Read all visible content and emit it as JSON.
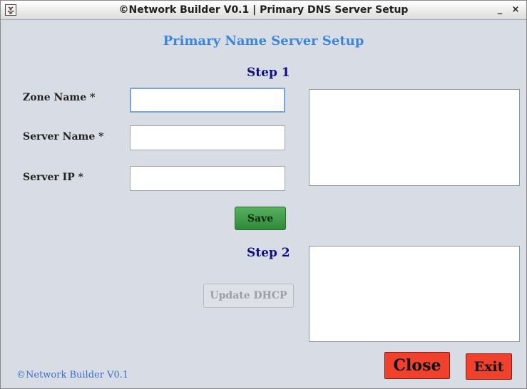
{
  "window": {
    "title": "©Network Builder V0.1 | Primary DNS Server Setup",
    "minimize_symbol": "_",
    "close_symbol": "×"
  },
  "form": {
    "heading": "Primary Name Server Setup",
    "step1": "Step 1",
    "step2": "Step 2",
    "zone_name_label": "Zone Name *",
    "zone_name_value": "",
    "server_name_label": "Server Name *",
    "server_name_value": "",
    "server_ip_label": "Server IP *",
    "server_ip_value": "",
    "save_label": "Save",
    "update_dhcp_label": "Update DHCP",
    "output1": "",
    "output2": ""
  },
  "actions": {
    "close_label": "Close",
    "exit_label": "Exit"
  },
  "footer": {
    "text": "©Network Builder V0.1"
  },
  "colors": {
    "background": "#d8dce4",
    "heading": "#3a86d8",
    "step": "#101080",
    "save_button": "#3d9a48",
    "danger_button": "#f0412c",
    "footer_text": "#3a6fc8"
  },
  "icons": {
    "app": "java-app-icon"
  }
}
